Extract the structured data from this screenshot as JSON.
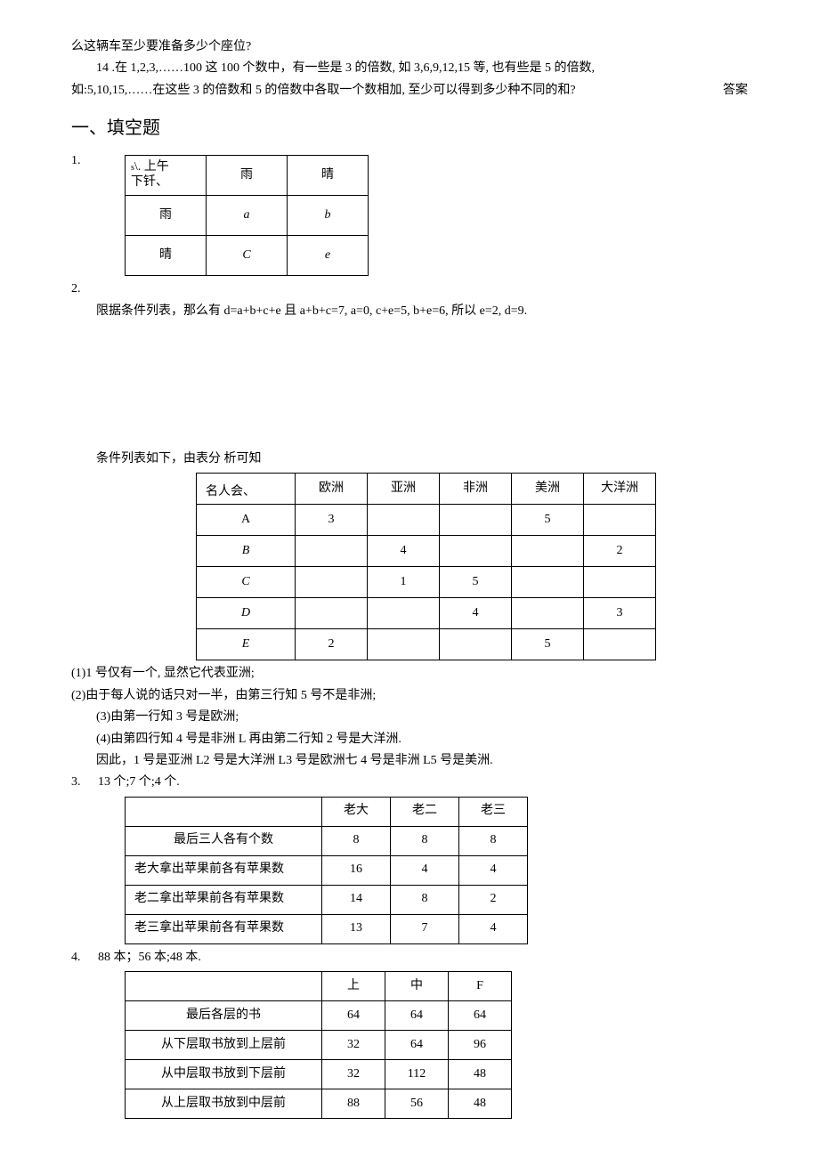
{
  "top": {
    "line1": "么这辆车至少要准备多少个座位?",
    "q14": "14 .在 1,2,3,……100 这 100 个数中，有一些是 3 的倍数, 如 3,6,9,12,15 等, 也有些是 5 的倍数,",
    "q14b": "如:5,10,15,……在这些 3 的倍数和 5 的倍数中各取一个数相加, 至少可以得到多少种不同的和?",
    "answer_label": "答案"
  },
  "section1": "一、填空题",
  "q1": {
    "num": "1.",
    "tbl": {
      "h0": "上午\n下午",
      "h1": "雨",
      "h2": "晴",
      "r1c0": "雨",
      "r1c1": "a",
      "r1c2": "b",
      "r2c0": "晴",
      "r2c1": "C",
      "r2c2": "e"
    }
  },
  "q2": {
    "num": "2.",
    "line": "限据条件列表，那么有 d=a+b+c+e 且 a+b+c=7, a=0, c+e=5, b+e=6, 所以 e=2, d=9.",
    "intro": "条件列表如下，由表分    析可知",
    "tbl": {
      "h0": "名人会、",
      "h1": "欧洲",
      "h2": "亚洲",
      "h3": "非洲",
      "h4": "美洲",
      "h5": "大洋洲",
      "rows": [
        {
          "n": "A",
          "v": [
            "3",
            "",
            "",
            "5",
            ""
          ]
        },
        {
          "n": "B",
          "v": [
            "",
            "4",
            "",
            "",
            "2"
          ]
        },
        {
          "n": "C",
          "v": [
            "",
            "1",
            "5",
            "",
            ""
          ]
        },
        {
          "n": "D",
          "v": [
            "",
            "",
            "4",
            "",
            "3"
          ]
        },
        {
          "n": "E",
          "v": [
            "2",
            "",
            "",
            "5",
            ""
          ]
        }
      ]
    },
    "notes": [
      "(1)1 号仅有一个, 显然它代表亚洲;",
      "(2)由于每人说的话只对一半，由第三行知 5 号不是非洲;",
      "(3)由第一行知 3 号是欧洲;",
      "(4)由第四行知 4 号是非洲 L 再由第二行知 2 号是大洋洲.",
      "因此，1 号是亚洲 L2 号是大洋洲 L3 号是欧洲七 4 号是非洲 L5 号是美洲."
    ]
  },
  "q3": {
    "num": "3.",
    "ans": "13 个;7 个;4 个.",
    "tbl": {
      "h": [
        "",
        "老大",
        "老二",
        "老三"
      ],
      "rows": [
        [
          "最后三人各有个数",
          "8",
          "8",
          "8"
        ],
        [
          "老大拿出苹果前各有苹果数",
          "16",
          "4",
          "4"
        ],
        [
          "老二拿出苹果前各有苹果数",
          "14",
          "8",
          "2"
        ],
        [
          "老三拿出苹果前各有苹果数",
          "13",
          "7",
          "4"
        ]
      ]
    }
  },
  "q4": {
    "num": "4.",
    "ans": "88 本；56 本;48 本.",
    "tbl": {
      "h": [
        "",
        "上",
        "中",
        "F"
      ],
      "rows": [
        [
          "最后各层的书",
          "64",
          "64",
          "64"
        ],
        [
          "从下层取书放到上层前",
          "32",
          "64",
          "96"
        ],
        [
          "从中层取书放到下层前",
          "32",
          "112",
          "48"
        ],
        [
          "从上层取书放到中层前",
          "88",
          "56",
          "48"
        ]
      ]
    }
  }
}
